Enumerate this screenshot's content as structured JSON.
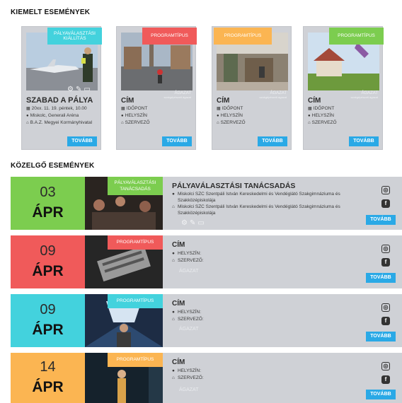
{
  "sections": {
    "featured_title": "KIEMELT ESEMÉNYEK",
    "upcoming_title": "KÖZELGŐ ESEMÉNYEK"
  },
  "featured": [
    {
      "tag": "PÁLYAVÁLASZTÁSI KIÁLLÍTÁS",
      "title": "SZABAD A PÁLYA",
      "date": "20xx. 11. 19. péntek, 10.00",
      "place": "Miskolc, Generali Aréna",
      "organizer": "B.A.Z. Megyei Kormányhivatal",
      "button": "TOVÁBB"
    },
    {
      "tag": "PROGRAMTÍPUS",
      "agazat": "ÁGAZAT",
      "agazat_sub": "szakgépészeti ágazat",
      "title": "CÍM",
      "date": "IDŐPONT",
      "place": "HELYSZÍN",
      "organizer": "SZERVEZŐ",
      "button": "TOVÁBB"
    },
    {
      "tag": "PROGRAMTÍPUS",
      "agazat": "ÁGAZAT",
      "agazat_sub": "szakgépészeti ágazat",
      "title": "CÍM",
      "date": "IDŐPONT",
      "place": "HELYSZÍN",
      "organizer": "SZERVEZŐ",
      "button": "TOVÁBB"
    },
    {
      "tag": "PROGRAMTÍPUS",
      "agazat": "ÁGAZAT",
      "agazat_sub": "szakgépészeti ágazat",
      "title": "CÍM",
      "date": "IDŐPONT",
      "place": "HELYSZÍN",
      "organizer": "SZERVEZŐ",
      "button": "TOVÁBB"
    }
  ],
  "upcoming": [
    {
      "day": "03",
      "month": "ÁPR",
      "tag": "PÁLYAVÁLASZTÁSI TANÁCSADÁS",
      "title": "PÁLYAVÁLASZTÁSI TANÁCSADÁS",
      "place": "Miskolci SZC Szentpáli István Kereskedelmi és Vendéglátó Szakgimnáziuma és Szakközépiskolája",
      "organizer": "Miskolci SZC Szentpáli István Kereskedelmi és Vendéglátó Szakgimnáziuma és Szakközépiskolája",
      "button": "TOVÁBB"
    },
    {
      "day": "09",
      "month": "ÁPR",
      "tag": "PROGRAMTÍPUS",
      "title": "CÍM",
      "place": "HELYSZÍN:",
      "organizer": "SZERVEZŐ:",
      "agazat": "ÁGAZAT",
      "button": "TOVÁBB"
    },
    {
      "day": "09",
      "month": "ÁPR",
      "tag": "PROGRAMTÍPUS",
      "title": "CÍM",
      "place": "HELYSZÍN:",
      "organizer": "SZERVEZŐ:",
      "agazat": "ÁGAZAT",
      "button": "TOVÁBB"
    },
    {
      "day": "14",
      "month": "ÁPR",
      "tag": "PROGRAMTÍPUS",
      "title": "CÍM",
      "place": "HELYSZÍN:",
      "organizer": "SZERVEZŐ:",
      "agazat": "ÁGAZAT",
      "button": "TOVÁBB"
    }
  ],
  "colors": {
    "green": "#7ccd4f",
    "red": "#f05a5a",
    "cyan": "#43d2dd",
    "orange": "#fbb552",
    "button_blue": "#2aa9e6",
    "card_gray": "#cfd1d6"
  },
  "icons": [
    "calendar-icon",
    "location-pin-icon",
    "home-icon",
    "gear-icon",
    "wrench-icon",
    "monitor-icon",
    "instagram-icon",
    "facebook-icon"
  ]
}
